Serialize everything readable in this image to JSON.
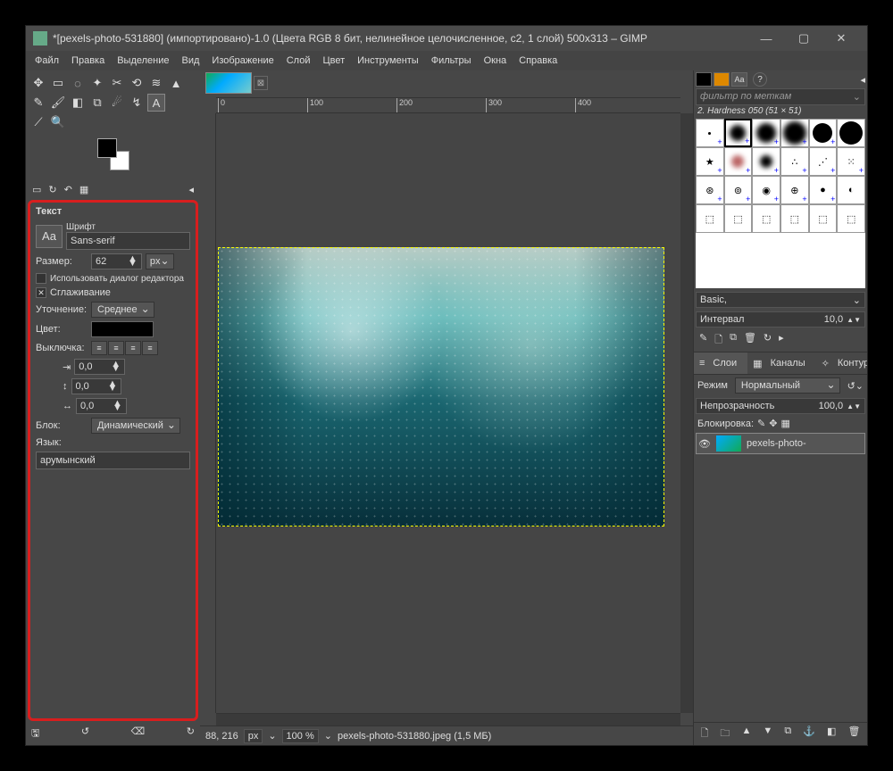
{
  "title": "*[pexels-photo-531880] (импортировано)-1.0 (Цвета RGB 8 бит, нелинейное целочисленное, c2, 1 слой) 500x313 – GIMP",
  "menu": [
    "Файл",
    "Правка",
    "Выделение",
    "Вид",
    "Изображение",
    "Слой",
    "Цвет",
    "Инструменты",
    "Фильтры",
    "Окна",
    "Справка"
  ],
  "tool_options": {
    "header": "Текст",
    "font_label": "Шрифт",
    "font_icon": "Aa",
    "font_name": "Sans-serif",
    "size_label": "Размер:",
    "size_value": "62",
    "size_unit": "px",
    "use_editor": "Использовать диалог редактора",
    "antialias": "Сглаживание",
    "hinting_label": "Уточнение:",
    "hinting_value": "Среднее",
    "color_label": "Цвет:",
    "justify_label": "Выключка:",
    "indent": "0,0",
    "line_spacing": "0,0",
    "letter_spacing": "0,0",
    "box_label": "Блок:",
    "box_value": "Динамический",
    "lang_label": "Язык:",
    "lang_value": "арумынский"
  },
  "ruler_ticks": [
    "0",
    "100",
    "200",
    "300",
    "400"
  ],
  "status": {
    "coords": "88, 216",
    "unit": "px",
    "zoom": "100 %",
    "filename": "pexels-photo-531880.jpeg (1,5 МБ)"
  },
  "brushes": {
    "filter_placeholder": "фильтр по меткам",
    "label": "2. Hardness 050 (51 × 51)",
    "preset": "Basic,",
    "spacing_label": "Интервал",
    "spacing_value": "10,0"
  },
  "layers": {
    "tab_layers": "Слои",
    "tab_channels": "Каналы",
    "tab_paths": "Контуры",
    "mode_label": "Режим",
    "mode_value": "Нормальный",
    "opacity_label": "Непрозрачность",
    "opacity_value": "100,0",
    "lock_label": "Блокировка:",
    "layer_name": "pexels-photo-"
  }
}
